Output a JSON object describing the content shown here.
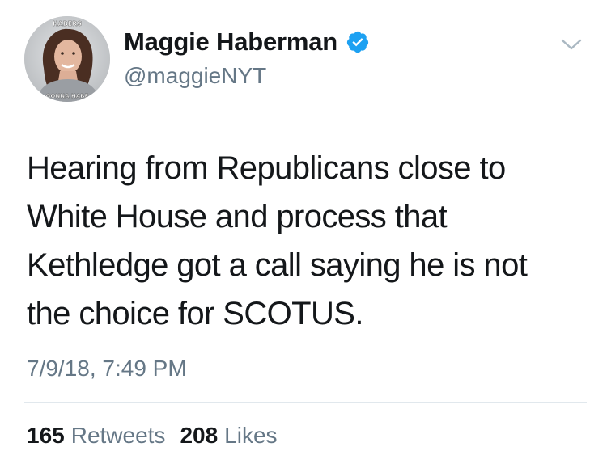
{
  "tweet": {
    "author": {
      "display_name": "Maggie Haberman",
      "handle": "@maggieNYT",
      "verified": true,
      "avatar_top_text": "HABERS",
      "avatar_bottom_text": "GONNA HABE"
    },
    "text": "Hearing from Republicans close to\nWhite House and process that\nKethledge got a call saying he is not\nthe choice for SCOTUS.",
    "timestamp": "7/9/18, 7:49 PM",
    "stats": {
      "retweets_count": "165",
      "retweets_label": "Retweets",
      "likes_count": "208",
      "likes_label": "Likes"
    },
    "icons": {
      "verified": "verified-badge-icon",
      "menu": "chevron-down-icon"
    },
    "colors": {
      "verified_blue": "#1da1f2",
      "secondary_text": "#657786",
      "primary_text": "#14171a"
    }
  }
}
